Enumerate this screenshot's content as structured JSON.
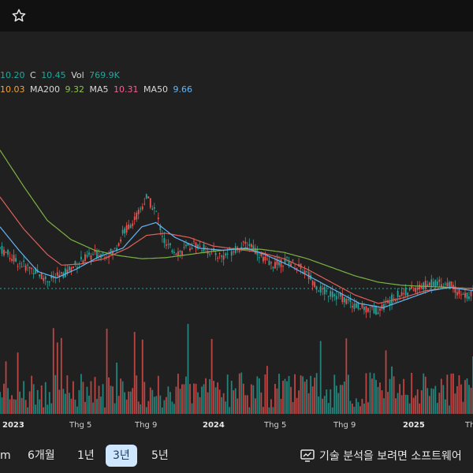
{
  "legend": {
    "row1": [
      {
        "label": "",
        "value": "10.20",
        "color": "#26a69a"
      },
      {
        "label": "C",
        "value": "10.45",
        "color": "#26a69a"
      },
      {
        "label": "Vol",
        "value": "769.9K",
        "color": "#26a69a"
      }
    ],
    "row2": [
      {
        "label": "",
        "value": "10.03",
        "color": "#f0a33a"
      },
      {
        "label": "MA200",
        "value": "9.32",
        "color": "#8bc34a"
      },
      {
        "label": "MA5",
        "value": "10.31",
        "color": "#f06292"
      },
      {
        "label": "MA50",
        "value": "9.66",
        "color": "#64b5f6"
      }
    ]
  },
  "x_axis_labels": [
    "2023",
    "Thg 5",
    "Thg 9",
    "2024",
    "Thg 5",
    "Thg 9",
    "2025",
    "Th"
  ],
  "timeframes": [
    {
      "label": "m",
      "active": false
    },
    {
      "label": "6개월",
      "active": false
    },
    {
      "label": "1년",
      "active": false
    },
    {
      "label": "3년",
      "active": true
    },
    {
      "label": "5년",
      "active": false
    }
  ],
  "tech_analysis_text": "기술 분석을 보려면 소프트웨어",
  "icons": {
    "star": "star-outline-icon",
    "tech": "monitor-chart-icon"
  },
  "colors": {
    "background": "#202020",
    "topbar": "#111111",
    "up": "#26a69a",
    "down": "#ef5350",
    "ma200": "#7cb342",
    "ma50": "#64b5f6",
    "ma_red": "#e0605a",
    "active_tab": "#cfe6ff"
  },
  "chart_data": {
    "type": "candlestick",
    "price_path": [
      [
        0,
        8.9
      ],
      [
        0.04,
        8.2
      ],
      [
        0.07,
        7.9
      ],
      [
        0.1,
        7.4
      ],
      [
        0.13,
        7.6
      ],
      [
        0.17,
        8.3
      ],
      [
        0.2,
        8.6
      ],
      [
        0.24,
        8.7
      ],
      [
        0.26,
        9.6
      ],
      [
        0.29,
        10.4
      ],
      [
        0.31,
        11.3
      ],
      [
        0.33,
        10.6
      ],
      [
        0.35,
        9.0
      ],
      [
        0.38,
        8.7
      ],
      [
        0.41,
        9.1
      ],
      [
        0.44,
        8.8
      ],
      [
        0.47,
        8.5
      ],
      [
        0.5,
        8.9
      ],
      [
        0.53,
        9.1
      ],
      [
        0.57,
        8.1
      ],
      [
        0.61,
        8.3
      ],
      [
        0.64,
        7.9
      ],
      [
        0.68,
        6.9
      ],
      [
        0.72,
        6.6
      ],
      [
        0.76,
        6.1
      ],
      [
        0.8,
        6.0
      ],
      [
        0.84,
        6.7
      ],
      [
        0.88,
        7.0
      ],
      [
        0.92,
        7.3
      ],
      [
        0.95,
        7.2
      ],
      [
        0.98,
        6.6
      ],
      [
        1.0,
        6.8
      ]
    ],
    "ma200_path": [
      [
        0,
        13.5
      ],
      [
        0.05,
        11.8
      ],
      [
        0.1,
        10.2
      ],
      [
        0.15,
        9.3
      ],
      [
        0.2,
        8.8
      ],
      [
        0.25,
        8.55
      ],
      [
        0.3,
        8.4
      ],
      [
        0.35,
        8.45
      ],
      [
        0.4,
        8.6
      ],
      [
        0.45,
        8.75
      ],
      [
        0.5,
        8.85
      ],
      [
        0.55,
        8.85
      ],
      [
        0.6,
        8.7
      ],
      [
        0.65,
        8.4
      ],
      [
        0.7,
        8.0
      ],
      [
        0.75,
        7.6
      ],
      [
        0.8,
        7.3
      ],
      [
        0.85,
        7.15
      ],
      [
        0.9,
        7.1
      ],
      [
        0.95,
        7.05
      ],
      [
        1.0,
        7.0
      ]
    ],
    "ma_red_path": [
      [
        0,
        11.3
      ],
      [
        0.05,
        9.8
      ],
      [
        0.1,
        8.6
      ],
      [
        0.13,
        8.1
      ],
      [
        0.17,
        8.15
      ],
      [
        0.22,
        8.4
      ],
      [
        0.27,
        8.9
      ],
      [
        0.31,
        9.5
      ],
      [
        0.35,
        9.6
      ],
      [
        0.4,
        9.4
      ],
      [
        0.45,
        9.0
      ],
      [
        0.5,
        8.85
      ],
      [
        0.55,
        8.7
      ],
      [
        0.6,
        8.4
      ],
      [
        0.65,
        7.9
      ],
      [
        0.7,
        7.3
      ],
      [
        0.75,
        6.7
      ],
      [
        0.8,
        6.3
      ],
      [
        0.85,
        6.55
      ],
      [
        0.9,
        6.9
      ],
      [
        0.95,
        7.05
      ],
      [
        1.0,
        7.0
      ]
    ],
    "ma50_path": [
      [
        0,
        9.9
      ],
      [
        0.04,
        8.8
      ],
      [
        0.08,
        7.8
      ],
      [
        0.12,
        7.5
      ],
      [
        0.16,
        7.9
      ],
      [
        0.21,
        8.5
      ],
      [
        0.26,
        8.9
      ],
      [
        0.3,
        9.9
      ],
      [
        0.33,
        10.1
      ],
      [
        0.37,
        9.4
      ],
      [
        0.42,
        8.9
      ],
      [
        0.47,
        8.8
      ],
      [
        0.52,
        8.9
      ],
      [
        0.56,
        8.6
      ],
      [
        0.61,
        8.1
      ],
      [
        0.66,
        7.5
      ],
      [
        0.71,
        6.9
      ],
      [
        0.76,
        6.3
      ],
      [
        0.81,
        6.1
      ],
      [
        0.86,
        6.5
      ],
      [
        0.91,
        6.9
      ],
      [
        0.95,
        7.05
      ],
      [
        1.0,
        6.9
      ]
    ],
    "price_range": [
      5,
      15
    ],
    "reference_price": 7.0
  }
}
